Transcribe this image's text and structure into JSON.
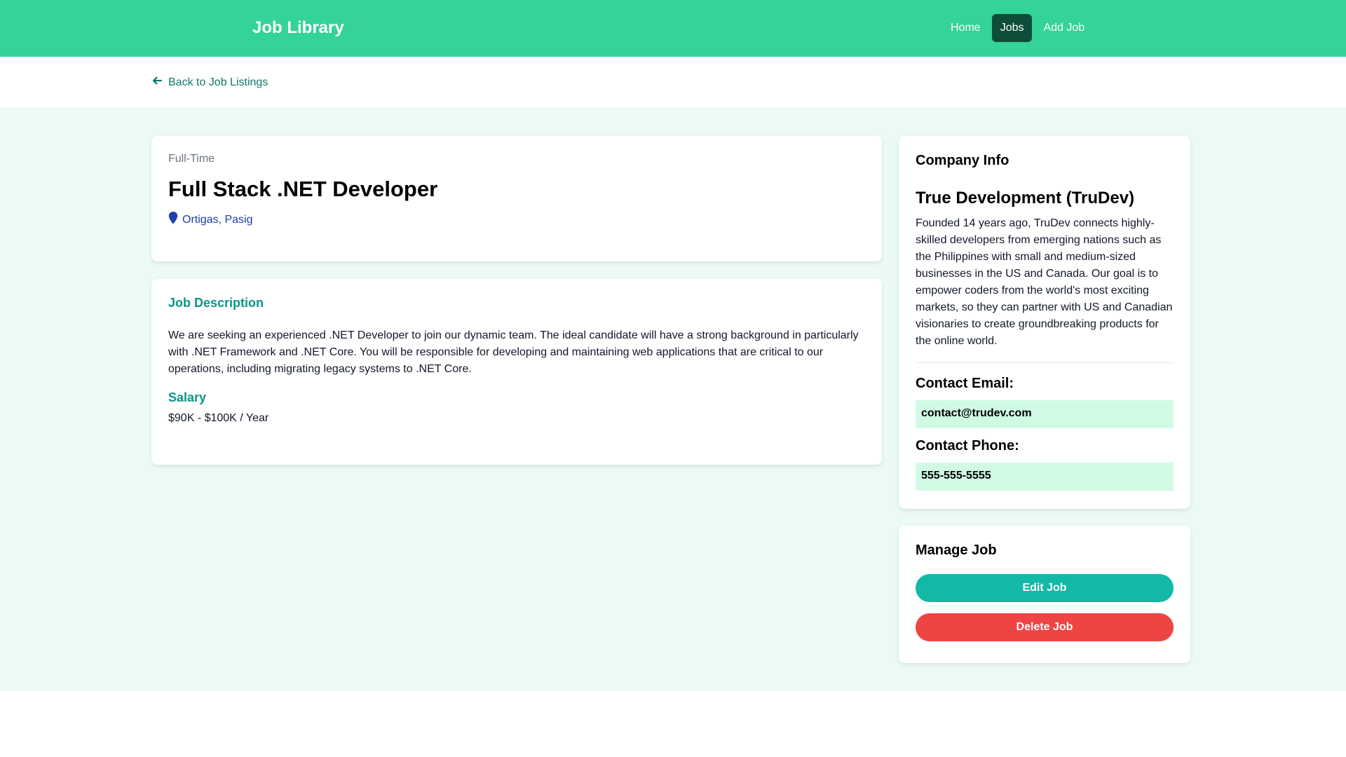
{
  "navbar": {
    "brand": "Job Library",
    "links": [
      {
        "label": "Home",
        "active": false
      },
      {
        "label": "Jobs",
        "active": true
      },
      {
        "label": "Add Job",
        "active": false
      }
    ]
  },
  "back_link": {
    "label": "Back to Job Listings",
    "icon": "arrow-left-icon"
  },
  "job": {
    "type": "Full-Time",
    "title": "Full Stack .NET Developer",
    "location": "Ortigas, Pasig",
    "location_icon": "map-marker-icon",
    "description_heading": "Job Description",
    "description": "We are seeking an experienced .NET Developer to join our dynamic team. The ideal candidate will have a strong background in particularly with .NET Framework and .NET Core. You will be responsible for developing and maintaining web applications that are critical to our operations, including migrating legacy systems to .NET Core.",
    "salary_heading": "Salary",
    "salary": "$90K - $100K / Year"
  },
  "company": {
    "heading": "Company Info",
    "name": "True Development (TruDev)",
    "description": "Founded 14 years ago, TruDev connects highly-skilled developers from emerging nations such as the Philippines with small and medium-sized businesses in the US and Canada. Our goal is to empower coders from the world's most exciting markets, so they can partner with US and Canadian visionaries to create groundbreaking products for the online world.",
    "email_label": "Contact Email:",
    "email": "contact@trudev.com",
    "phone_label": "Contact Phone:",
    "phone": "555-555-5555"
  },
  "manage": {
    "heading": "Manage Job",
    "edit_label": "Edit Job",
    "delete_label": "Delete Job"
  },
  "colors": {
    "navbar": "#34d399",
    "active_nav": "#0f4c3a",
    "accent": "#0d9488",
    "page_bg": "#ebfbf3",
    "edit_button": "#14b8a6",
    "delete_button": "#ef4444",
    "contact_bg": "#d1fae5"
  }
}
